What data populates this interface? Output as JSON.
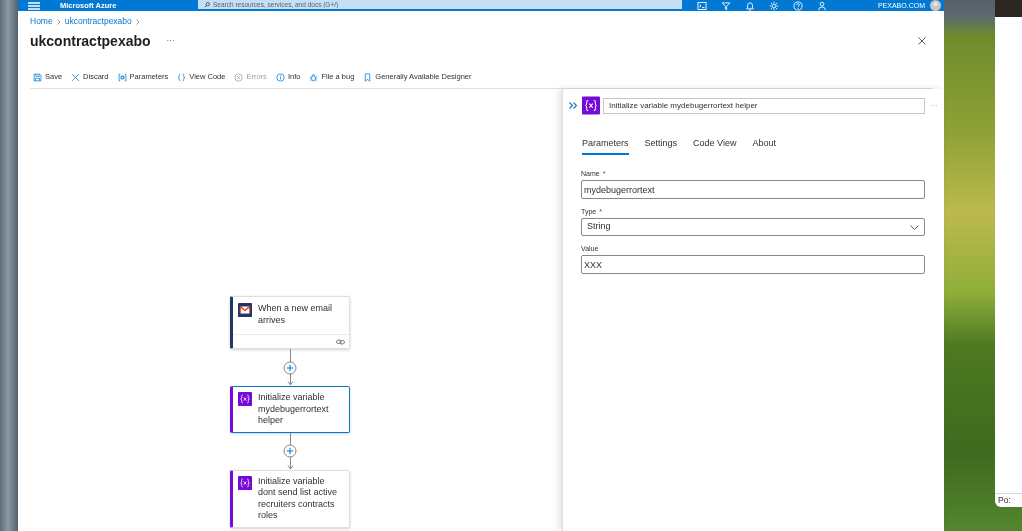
{
  "top_bar": {
    "title": "Microsoft Azure",
    "search": {
      "placeholder": "Search resources, services, and docs (G+/)"
    },
    "account": "PEXABO.COM"
  },
  "breadcrumb": [
    "Home",
    "ukcontractpexabo"
  ],
  "page": {
    "title": "ukcontractpexabo",
    "more": "···"
  },
  "toolbar": [
    {
      "kind": "save",
      "label": "Save",
      "disabled": false
    },
    {
      "kind": "discard",
      "label": "Discard",
      "disabled": false
    },
    {
      "kind": "parameters",
      "label": "Parameters",
      "disabled": false
    },
    {
      "kind": "code",
      "label": "View Code",
      "disabled": false
    },
    {
      "kind": "errors",
      "label": "Errors",
      "disabled": true
    },
    {
      "kind": "info",
      "label": "Info",
      "disabled": false
    },
    {
      "kind": "bug",
      "label": "File a bug",
      "disabled": false
    },
    {
      "kind": "designer",
      "label": "Generally Available Designer",
      "disabled": false
    }
  ],
  "canvas": {
    "nodes": [
      {
        "kind": "trigger",
        "title": "When a new email arrives",
        "selected": false
      },
      {
        "kind": "variable",
        "title": "Initialize variable mydebugerrortext helper",
        "selected": true
      },
      {
        "kind": "variable",
        "title": "Initialize variable dont send list active recruiters contracts roles",
        "selected": false
      }
    ]
  },
  "panel": {
    "title": "Initialize variable mydebugerrortext helper",
    "more": "···",
    "tabs": [
      {
        "label": "Parameters",
        "selected": true
      },
      {
        "label": "Settings",
        "selected": false
      },
      {
        "label": "Code View",
        "selected": false
      },
      {
        "label": "About",
        "selected": false
      }
    ],
    "fields": [
      {
        "kind": "text",
        "label": "Name",
        "required_mark": "*",
        "value": "mydebugerrortext"
      },
      {
        "kind": "select",
        "label": "Type",
        "required_mark": "*",
        "value": "String"
      },
      {
        "kind": "text",
        "label": "Value",
        "value": "XXX"
      }
    ]
  },
  "side_window": {
    "text": "Po:"
  }
}
